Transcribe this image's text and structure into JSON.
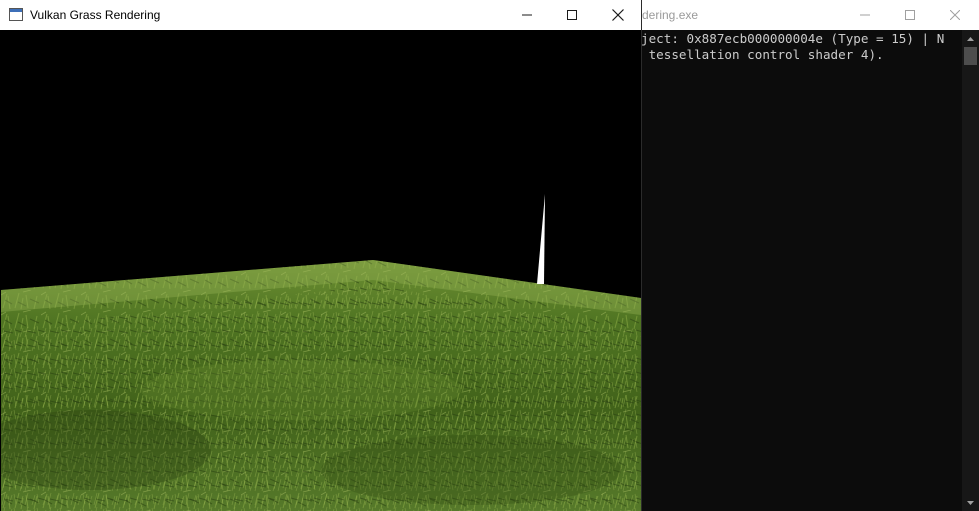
{
  "console_window": {
    "title": "dering.exe",
    "controls": [
      "minimize-icon",
      "maximize-icon",
      "close-icon"
    ],
    "lines": [
      "ject: 0x887ecb000000004e (Type = 15) | N",
      " tessellation control shader 4)."
    ]
  },
  "app_window": {
    "title": "Vulkan Grass Rendering",
    "icon": "window-app-icon",
    "controls": [
      "minimize-icon",
      "maximize-icon",
      "close-icon"
    ]
  },
  "colors": {
    "console_bg": "#0c0c0c",
    "console_text": "#cccccc",
    "titlebar": "#ffffff",
    "grass_dark": "#2f4a14",
    "grass_mid": "#4f7a22",
    "grass_light": "#8fae46",
    "blade": "#ffffff"
  }
}
